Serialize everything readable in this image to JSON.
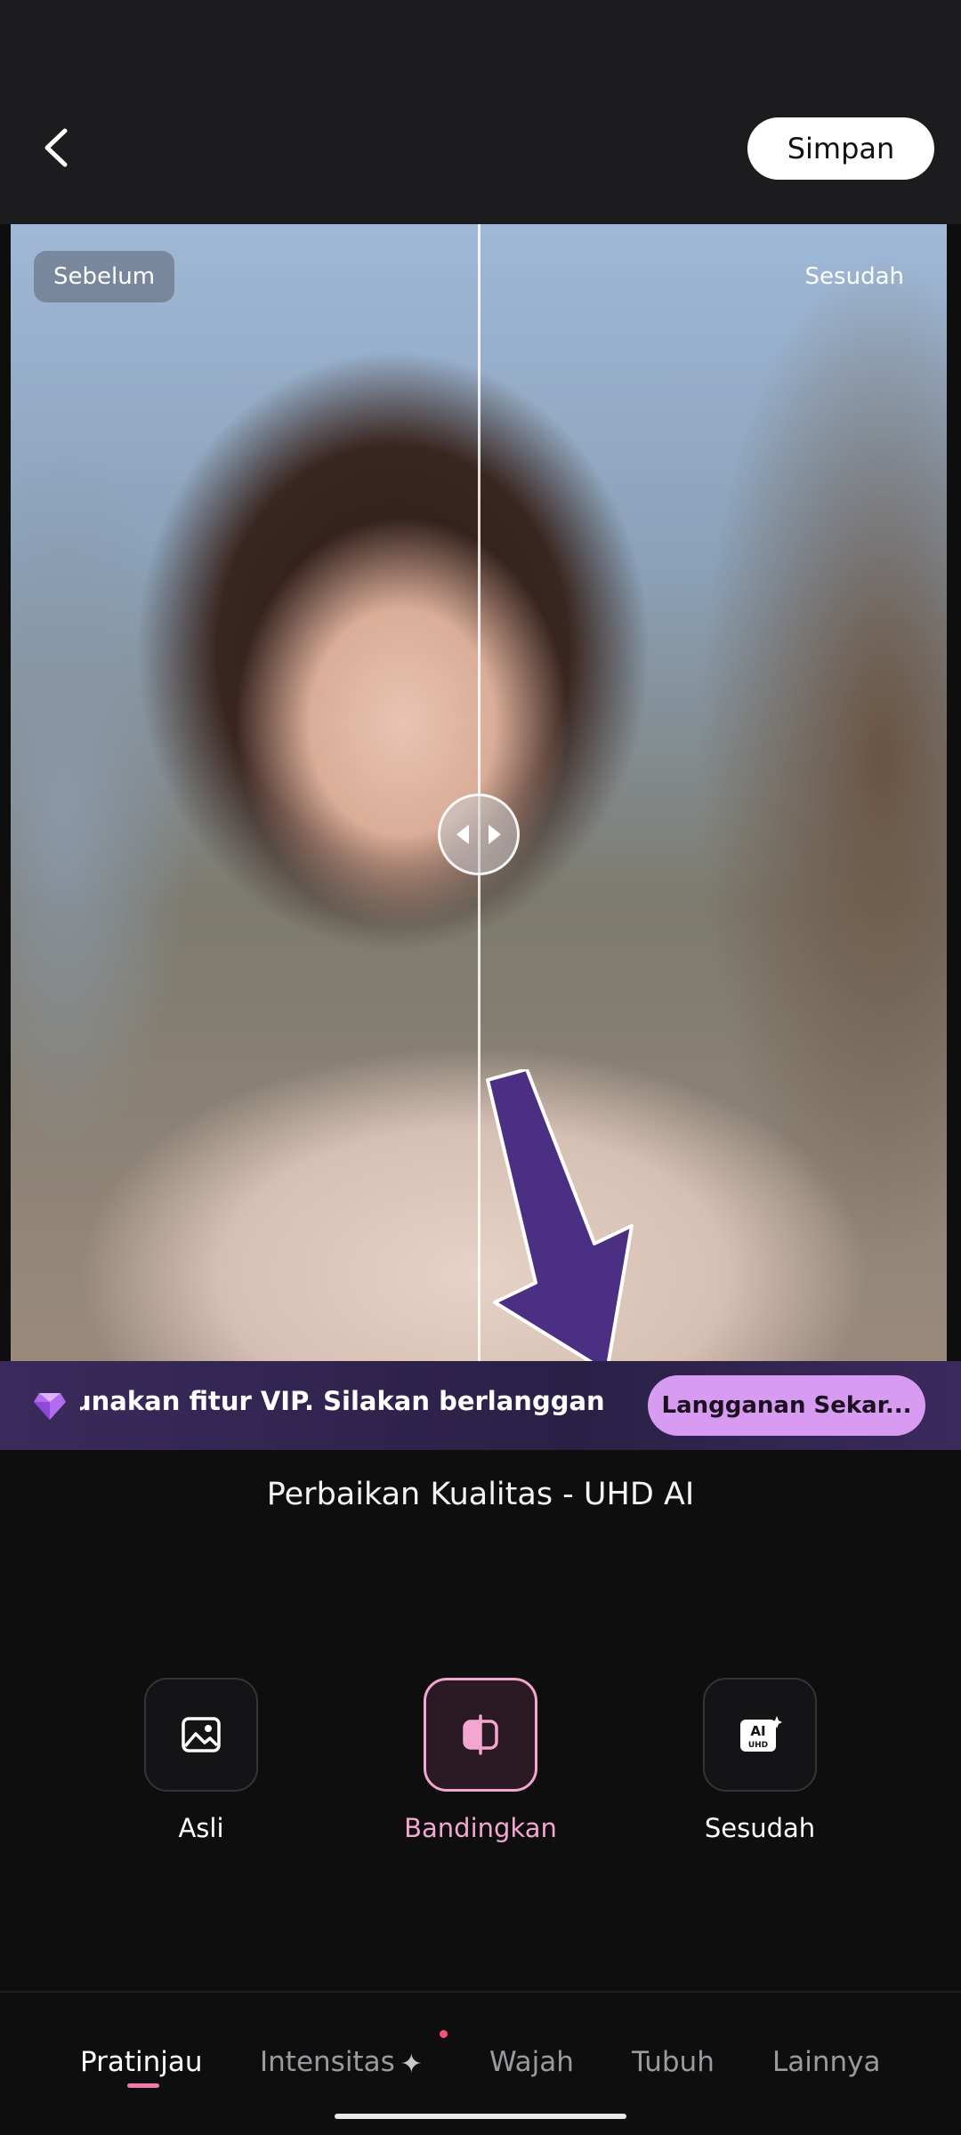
{
  "header": {
    "back_icon": "chevron-left-icon",
    "save_label": "Simpan"
  },
  "preview": {
    "before_label": "Sebelum",
    "after_label": "Sesudah",
    "handle_icon": "compare-slider-icon"
  },
  "vip_banner": {
    "icon": "diamond-gem-icon",
    "message": "unakan fitur VIP. Silakan berlanggan",
    "button_label": "Langganan Sekar..."
  },
  "feature_title": "Perbaikan Kualitas - UHD AI",
  "modes": [
    {
      "label": "Asli",
      "icon": "image-icon",
      "active": false
    },
    {
      "label": "Bandingkan",
      "icon": "compare-icon",
      "active": true
    },
    {
      "label": "Sesudah",
      "icon": "ai-uhd-icon",
      "active": false
    }
  ],
  "tabs": [
    {
      "label": "Pratinjau",
      "active": true
    },
    {
      "label": "Intensitas",
      "active": false,
      "has_sparkle": true,
      "has_dot": true
    },
    {
      "label": "Wajah",
      "active": false
    },
    {
      "label": "Tubuh",
      "active": false
    },
    {
      "label": "Lainnya",
      "active": false
    }
  ],
  "colors": {
    "accent_pink": "#f3a6cf",
    "vip_button": "#d79bf2",
    "vip_banner": "#2a2046",
    "arrow_overlay": "#4b2f82"
  }
}
